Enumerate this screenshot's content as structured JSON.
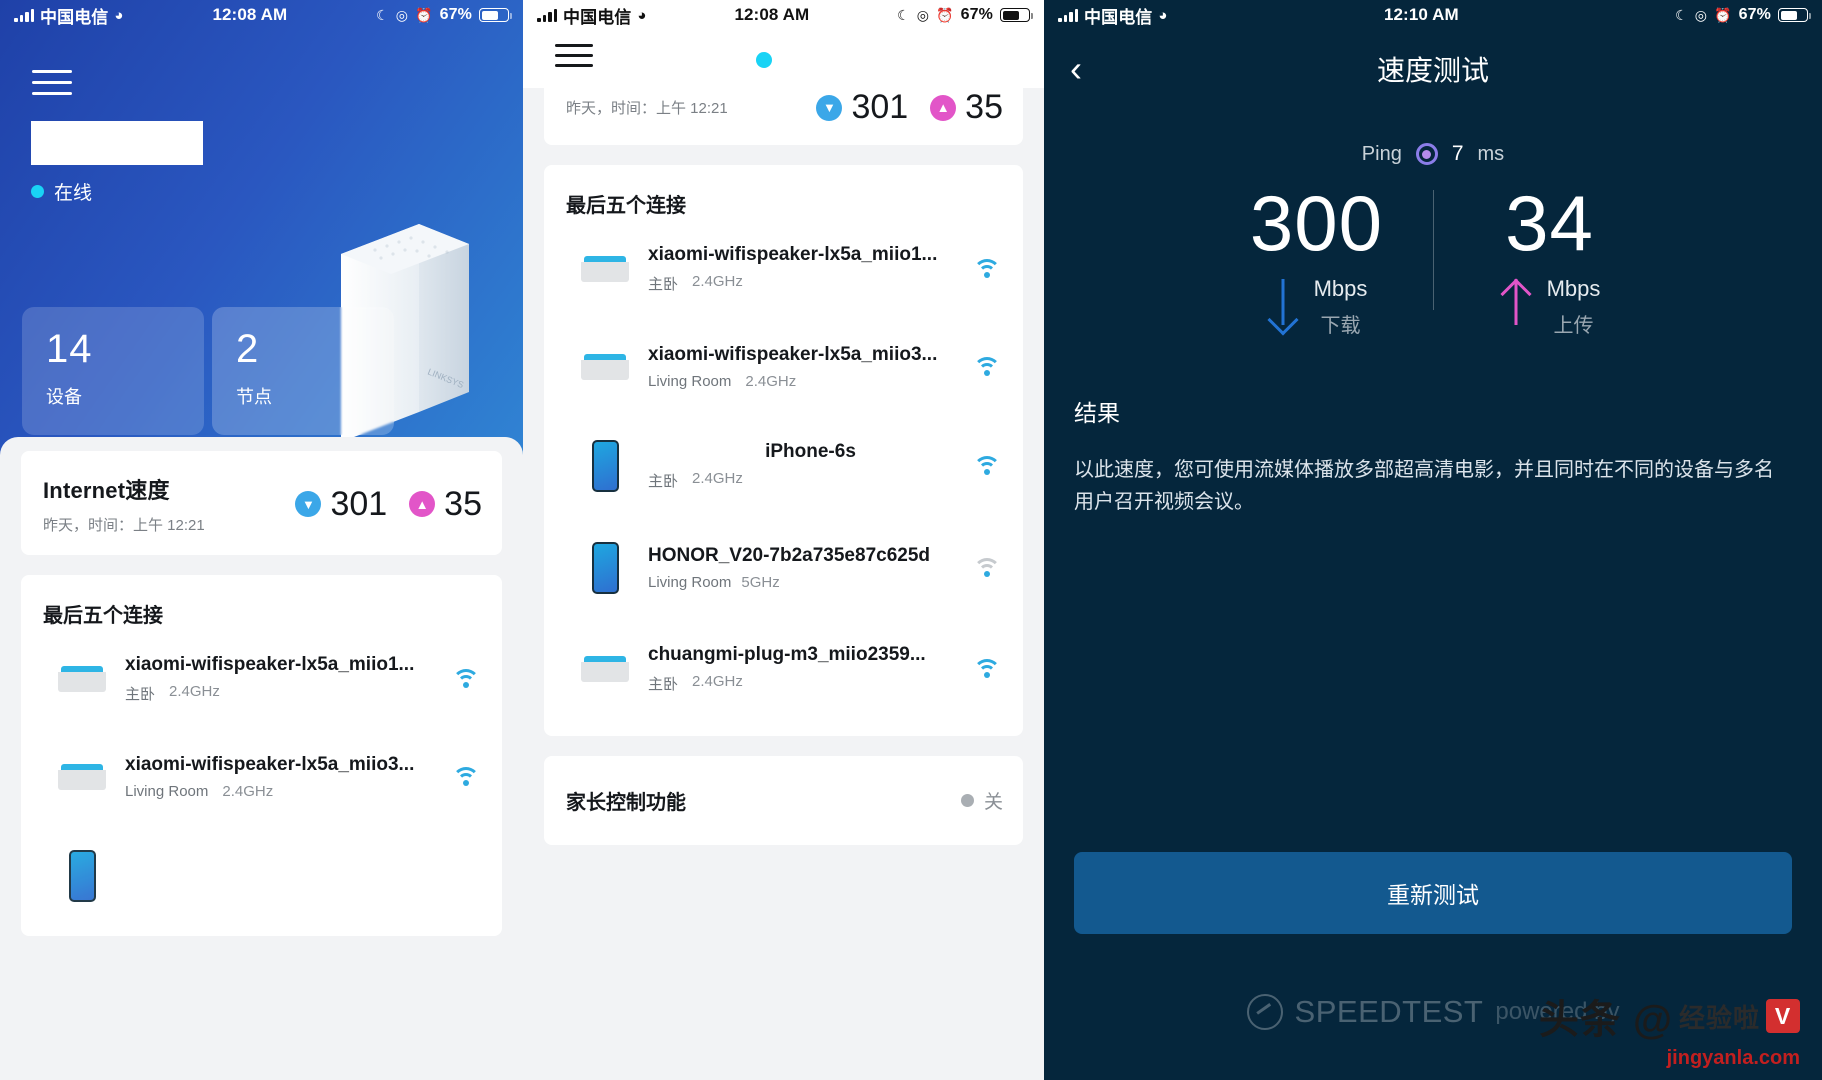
{
  "panel1": {
    "statusbar": {
      "carrier": "中国电信",
      "time": "12:08 AM",
      "battery": "67%"
    },
    "online_label": "在线",
    "stats": [
      {
        "value": "14",
        "label": "设备"
      },
      {
        "value": "2",
        "label": "节点"
      }
    ],
    "speed_card": {
      "title": "Internet速度",
      "subtitle": "昨天，时间：上午 12:21",
      "download": "301",
      "upload": "35"
    },
    "list_title": "最后五个连接",
    "devices": [
      {
        "name": "xiaomi-wifispeaker-lx5a_miio1...",
        "room": "主卧",
        "band": "2.4GHz",
        "icon": "speaker-puck-icon",
        "signal": "strong"
      },
      {
        "name": "xiaomi-wifispeaker-lx5a_miio3...",
        "room": "Living Room",
        "band": "2.4GHz",
        "icon": "speaker-puck-icon",
        "signal": "strong"
      }
    ]
  },
  "panel2": {
    "statusbar": {
      "carrier": "中国电信",
      "time": "12:08 AM",
      "battery": "67%"
    },
    "speed_card": {
      "subtitle": "昨天，时间：上午 12:21",
      "download": "301",
      "upload": "35"
    },
    "list_title": "最后五个连接",
    "devices": [
      {
        "name": "xiaomi-wifispeaker-lx5a_miio1...",
        "room": "主卧",
        "band": "2.4GHz",
        "icon": "speaker-puck-icon",
        "signal": "strong"
      },
      {
        "name": "xiaomi-wifispeaker-lx5a_miio3...",
        "room": "Living Room",
        "band": "2.4GHz",
        "icon": "speaker-puck-icon",
        "signal": "strong"
      },
      {
        "name": "iPhone-6s",
        "room": "主卧",
        "band": "2.4GHz",
        "icon": "phone-icon",
        "signal": "strong"
      },
      {
        "name": "HONOR_V20-7b2a735e87c625d",
        "room": "Living Room",
        "band": "5GHz",
        "icon": "phone-icon",
        "signal": "weak"
      },
      {
        "name": "chuangmi-plug-m3_miio2359...",
        "room": "主卧",
        "band": "2.4GHz",
        "icon": "speaker-puck-icon",
        "signal": "strong"
      }
    ],
    "parental": {
      "label": "家长控制功能",
      "state": "关"
    }
  },
  "panel3": {
    "statusbar": {
      "carrier": "中国电信",
      "time": "12:10 AM",
      "battery": "67%"
    },
    "title": "速度测试",
    "ping": {
      "label": "Ping",
      "value": "7",
      "unit": "ms"
    },
    "download": {
      "value": "300",
      "unit": "Mbps",
      "label": "下载"
    },
    "upload": {
      "value": "34",
      "unit": "Mbps",
      "label": "上传"
    },
    "result_heading": "结果",
    "result_text": "以此速度，您可使用流媒体播放多部超高清电影，并且同时在不同的设备与多名用户召开视频会议。",
    "retest_button": "重新测试",
    "footer_brand": "SPEEDTEST",
    "footer_by": "powered by"
  },
  "watermark": {
    "main": "头条 @",
    "badge": "V",
    "sub": "jingyanla.com",
    "handle": "经验啦"
  },
  "colors": {
    "accent_blue": "#19d3f5",
    "download_blue": "#2e9fe0",
    "upload_pink": "#e255c8",
    "dark_bg": "#05263c",
    "button_blue": "#13598f"
  }
}
